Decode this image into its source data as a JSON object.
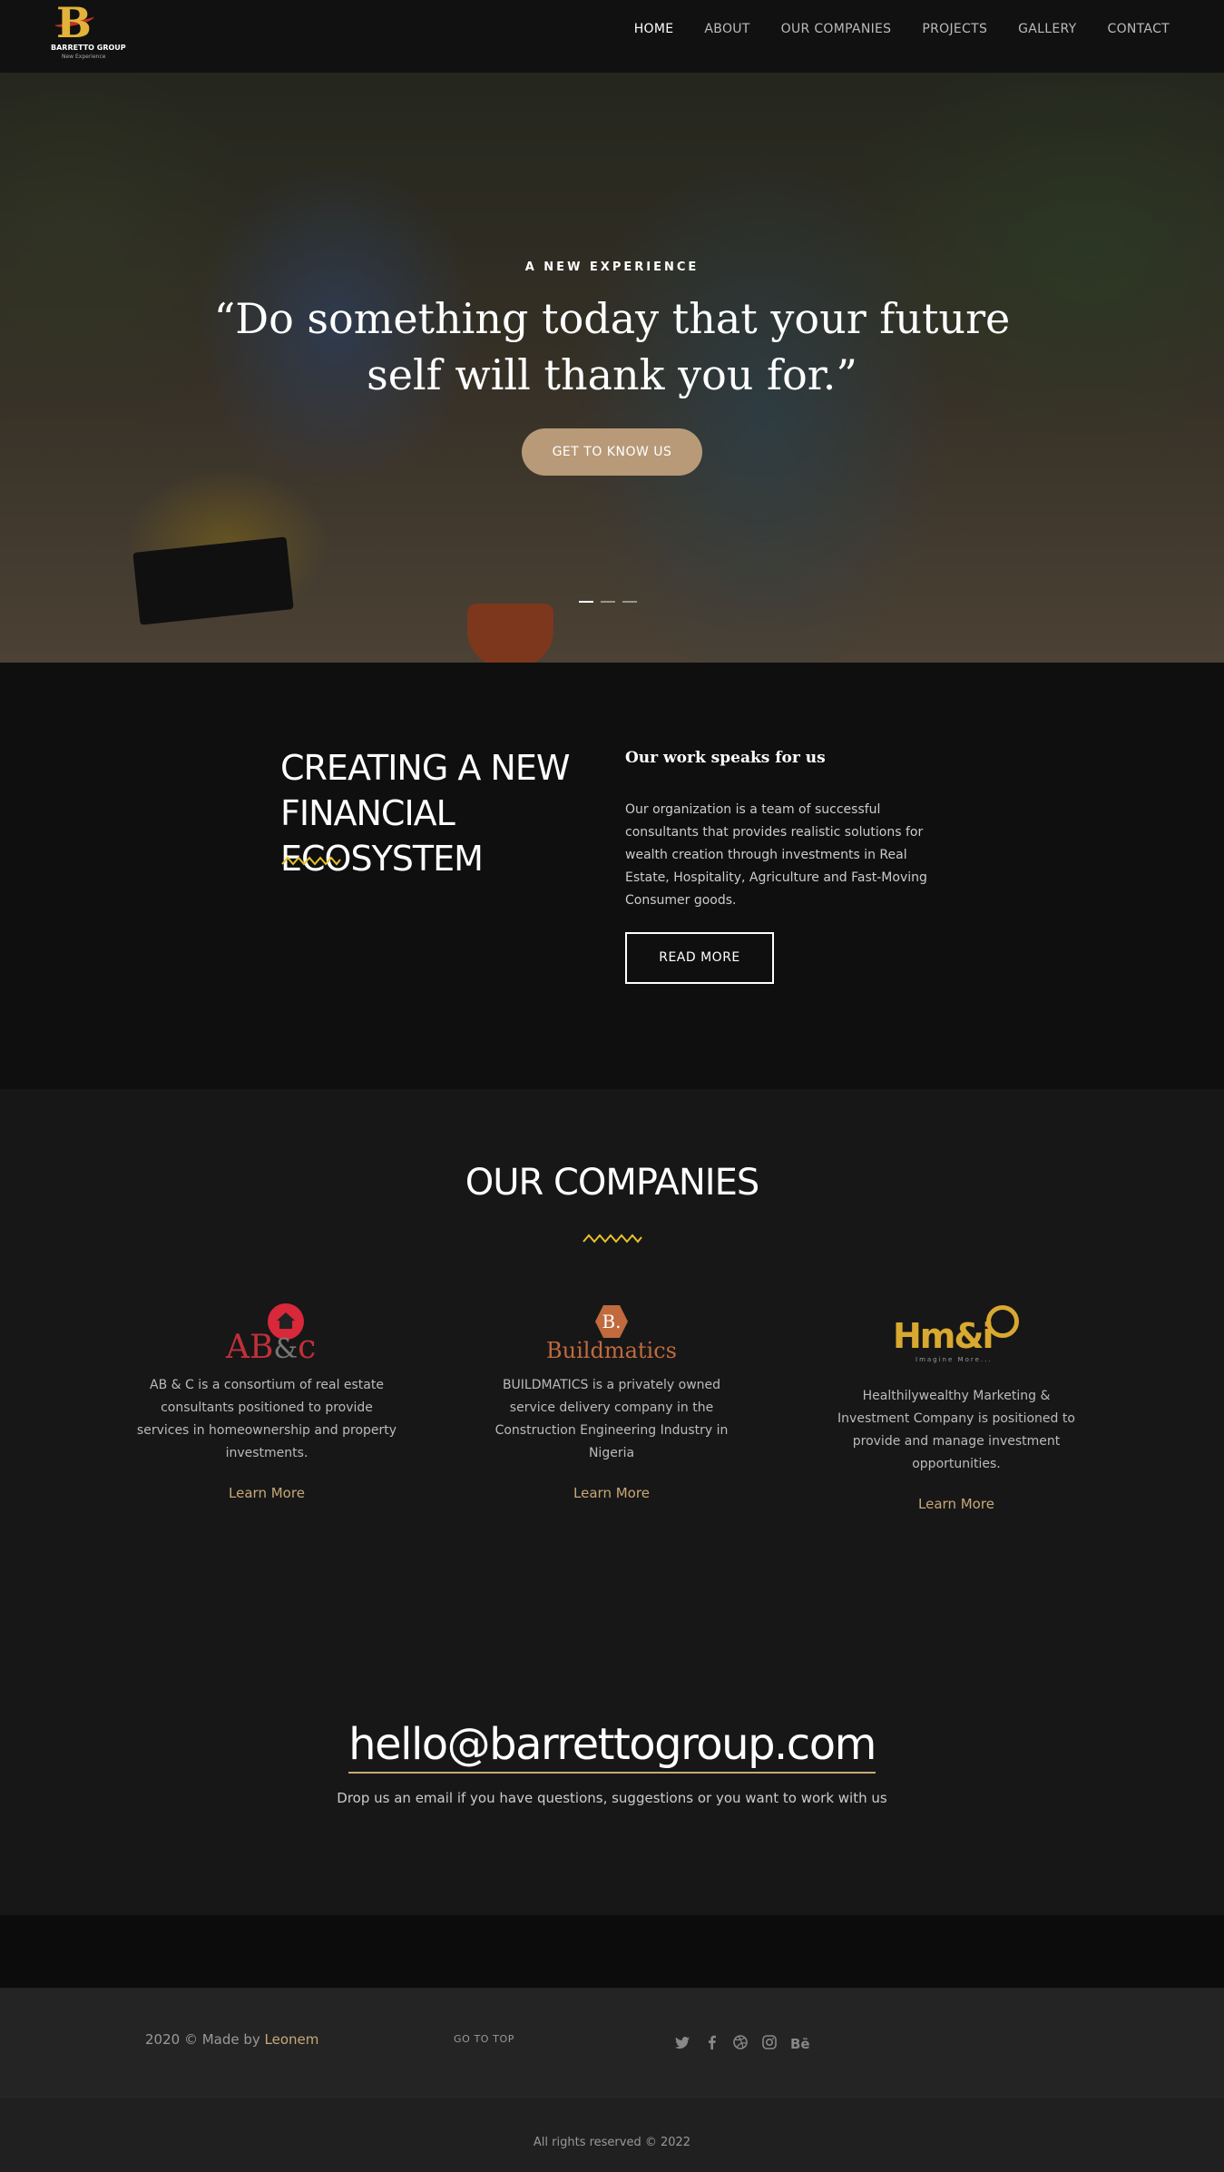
{
  "brand": {
    "name": "BARRETTO GROUP",
    "tagline": "New Experience"
  },
  "nav": {
    "items": [
      "HOME",
      "ABOUT",
      "OUR COMPANIES",
      "PROJECTS",
      "GALLERY",
      "CONTACT"
    ],
    "active": "HOME"
  },
  "hero": {
    "kicker": "A NEW EXPERIENCE",
    "quote": "“Do something today that your future self will thank you for.”",
    "cta": "GET TO KNOW US",
    "slides": 3,
    "active_slide": 1
  },
  "about": {
    "heading": "CREATING A NEW FINANCIAL ECOSYSTEM",
    "subheading": "Our work speaks for us",
    "body": "Our organization is a team of successful consultants that provides realistic solutions for wealth creation through investments in Real Estate, Hospitality, Agriculture and Fast-Moving Consumer goods.",
    "button": "READ MORE"
  },
  "companies": {
    "heading": "OUR COMPANIES",
    "items": [
      {
        "logo": "AB&c",
        "description": "AB & C is a consortium of real estate consultants positioned to provide services in homeownership and property investments.",
        "link": "Learn More"
      },
      {
        "logo": "Buildmatics",
        "logo_mark": "B.",
        "description": "BUILDMATICS is a privately owned service delivery company in the Construction Engineering Industry in Nigeria",
        "link": "Learn More"
      },
      {
        "logo": "Hm&i",
        "logo_sub": "Imagine More...",
        "description": "Healthilywealthy Marketing & Investment Company is positioned to provide and manage investment opportunities.",
        "link": "Learn More"
      }
    ]
  },
  "contact": {
    "email": "hello@barrettogroup.com",
    "text": "Drop us an email if you have questions, suggestions or you want to work with us"
  },
  "footer": {
    "made_prefix": "2020 © Made by",
    "made_by": "Leonem",
    "go_top": "GO TO TOP",
    "social_icons": [
      "twitter-icon",
      "facebook-icon",
      "dribbble-icon",
      "instagram-icon",
      "behance-icon"
    ],
    "rights": "All rights reserved © 2022"
  },
  "colors": {
    "accent": "#c8a878",
    "zigzag": "#e8c12e",
    "background": "#111111"
  }
}
